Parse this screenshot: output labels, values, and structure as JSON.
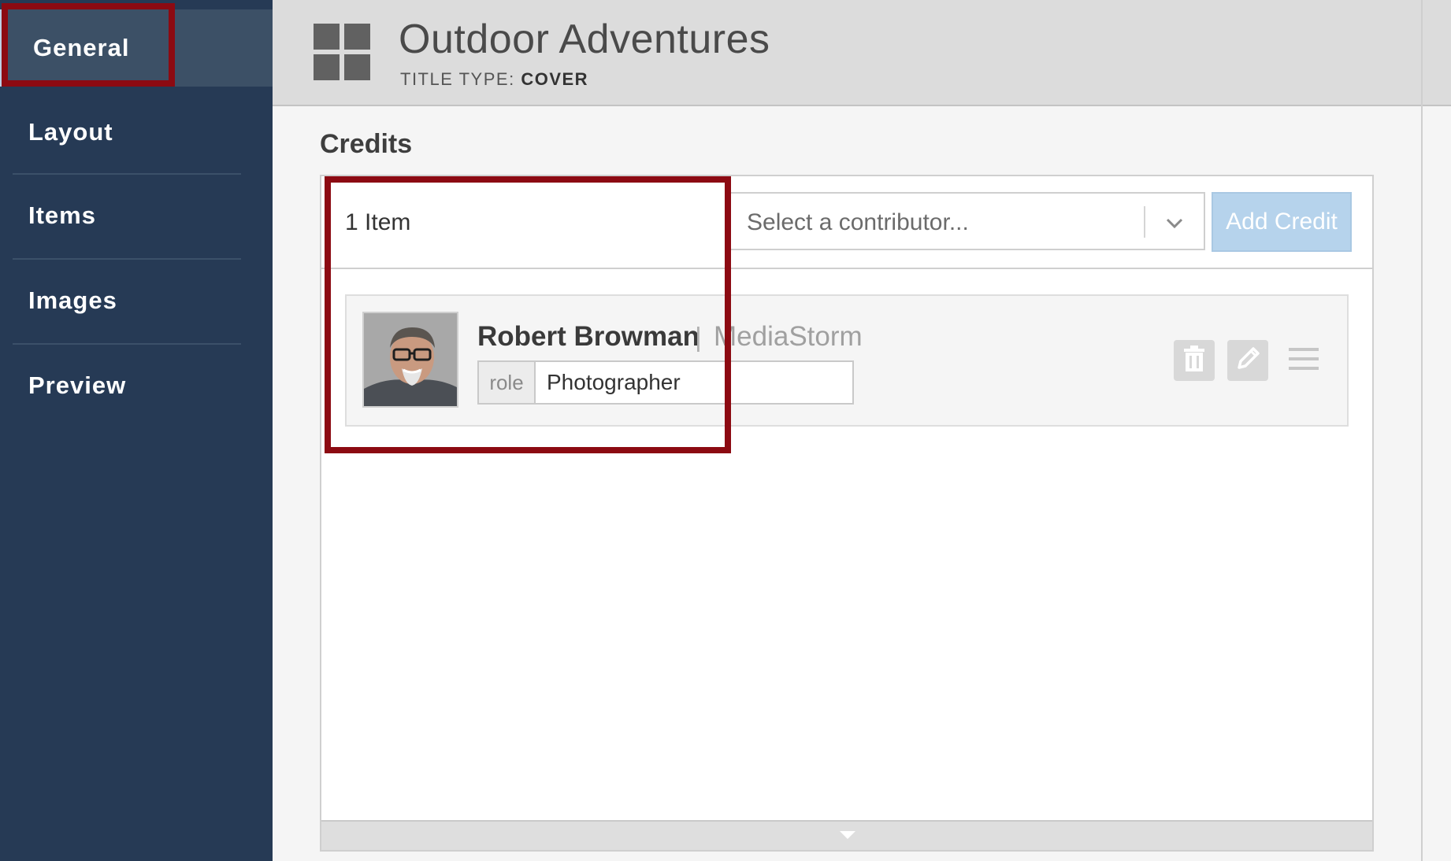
{
  "sidebar": {
    "items": [
      {
        "label": "General",
        "active": true
      },
      {
        "label": "Layout",
        "active": false
      },
      {
        "label": "Items",
        "active": false
      },
      {
        "label": "Images",
        "active": false
      },
      {
        "label": "Preview",
        "active": false
      }
    ]
  },
  "header": {
    "title": "Outdoor Adventures",
    "title_type_label": "TITLE TYPE:",
    "title_type_value": "COVER",
    "icon": "grid-icon"
  },
  "credits": {
    "section_title": "Credits",
    "item_count": "1 Item",
    "contributor_select": {
      "placeholder": "Select a contributor..."
    },
    "add_button": "Add Credit",
    "entries": [
      {
        "name": "Robert Browman",
        "separator": "|",
        "organization": "MediaStorm",
        "role_label": "role",
        "role_value": "Photographer",
        "actions": [
          "trash-icon",
          "pencil-icon",
          "drag-handle-icon"
        ]
      }
    ]
  },
  "colors": {
    "sidebar_bg": "#263a55",
    "sidebar_active_bg": "#3c5066",
    "header_bg": "#dcdcdc",
    "annotation_red": "#8c0a12",
    "add_button_bg": "#b6d3ec"
  }
}
